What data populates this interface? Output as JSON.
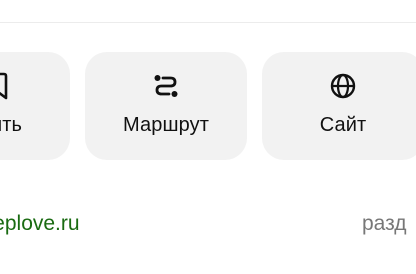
{
  "colors": {
    "button_bg": "#f2f2f2",
    "text_primary": "#111111",
    "link_green": "#1a6b12",
    "text_secondary": "#777777"
  },
  "actions": {
    "save": {
      "label": "нить",
      "icon": "bookmark-icon"
    },
    "route": {
      "label": "Маршрут",
      "icon": "route-icon"
    },
    "site": {
      "label": "Сайт",
      "icon": "globe-icon"
    }
  },
  "footer": {
    "site_url": "weplove.ru",
    "section_text": "разд"
  }
}
